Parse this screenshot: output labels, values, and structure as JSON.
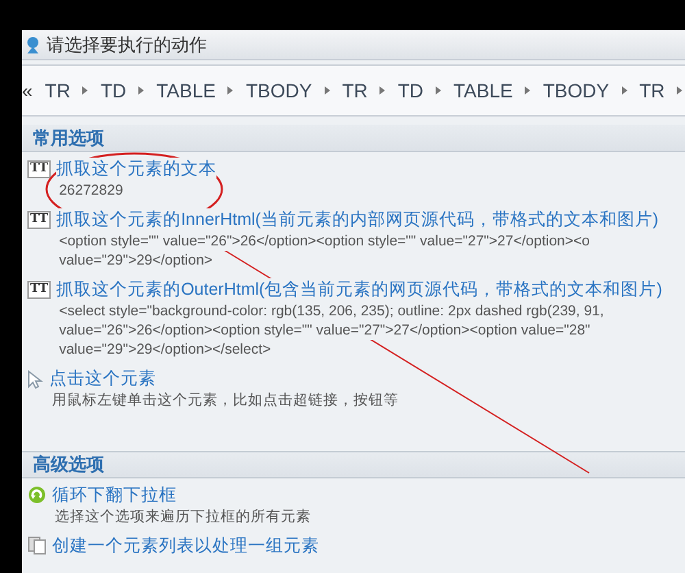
{
  "window": {
    "title": "请选择要执行的动作"
  },
  "breadcrumb": {
    "back": "«",
    "items": [
      "TR",
      "TD",
      "TABLE",
      "TBODY",
      "TR",
      "TD",
      "TABLE",
      "TBODY",
      "TR"
    ]
  },
  "sections": [
    {
      "title": "常用选项",
      "items": [
        {
          "kind": "text",
          "icon_text": "TT",
          "label": "抓取这个元素的文本",
          "details": [
            "26272829"
          ]
        },
        {
          "kind": "text",
          "icon_text": "TT",
          "label": "抓取这个元素的InnerHtml(当前元素的内部网页源代码，带格式的文本和图片)",
          "details": [
            "<option style=\"\" value=\"26\">26</option><option style=\"\" value=\"27\">27</option><o",
            "value=\"29\">29</option>"
          ]
        },
        {
          "kind": "text",
          "icon_text": "TT",
          "label": "抓取这个元素的OuterHtml(包含当前元素的网页源代码，带格式的文本和图片)",
          "details": [
            "<select style=\"background-color: rgb(135, 206, 235); outline: 2px dashed rgb(239, 91,",
            "value=\"26\">26</option><option style=\"\" value=\"27\">27</option><option value=\"28\"",
            "value=\"29\">29</option></select>"
          ]
        },
        {
          "kind": "click",
          "label": "点击这个元素",
          "details": [
            "用鼠标左键单击这个元素，比如点击超链接，按钮等"
          ]
        }
      ]
    },
    {
      "title": "高级选项",
      "items": [
        {
          "kind": "loop",
          "label": "循环下翻下拉框",
          "details": [
            "选择这个选项来遍历下拉框的所有元素"
          ]
        },
        {
          "kind": "list",
          "label": "创建一个元素列表以处理一组元素"
        }
      ]
    }
  ]
}
